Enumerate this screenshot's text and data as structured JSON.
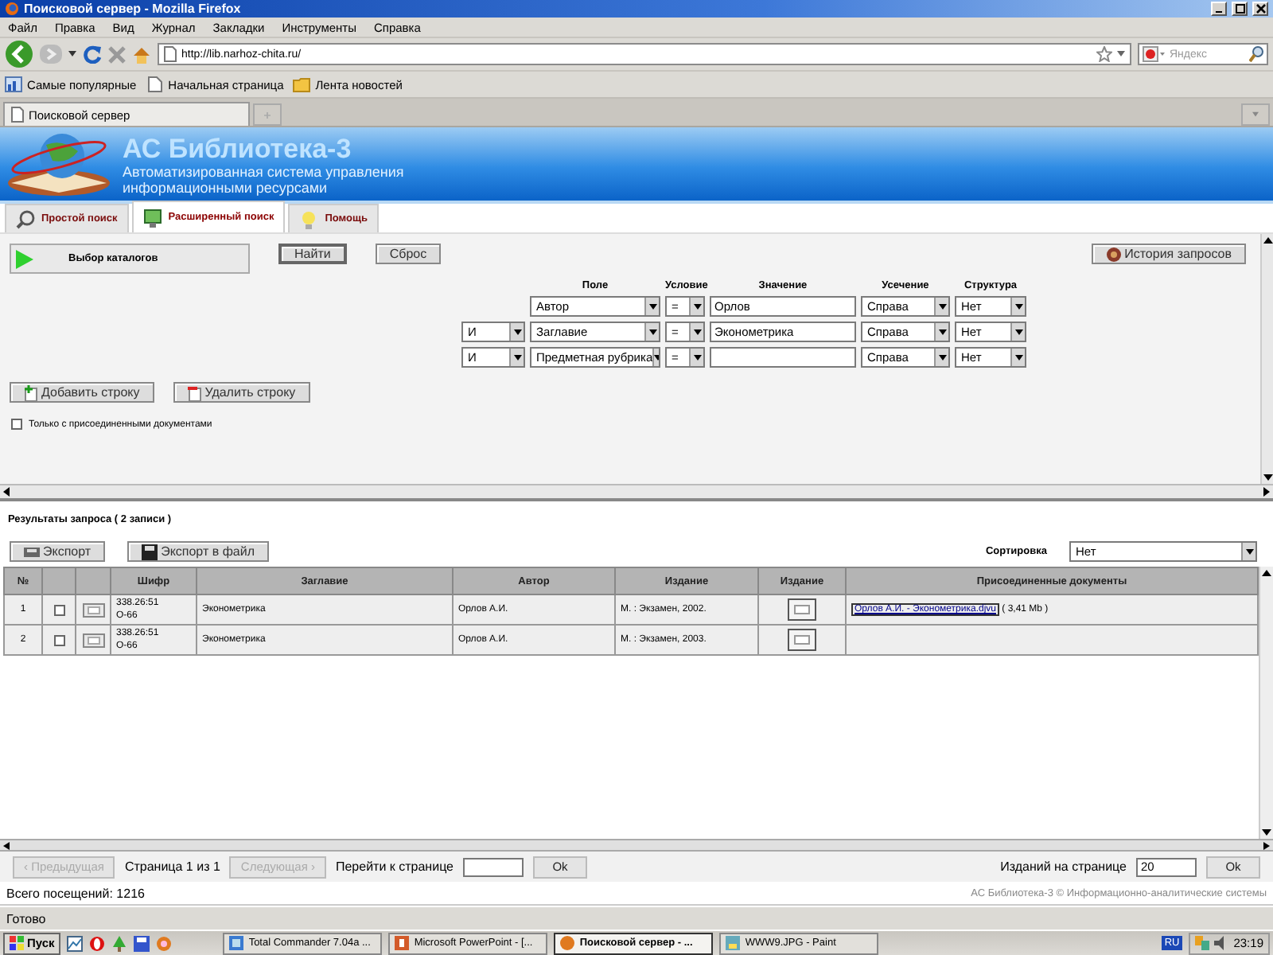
{
  "window": {
    "title": "Поисковой сервер - Mozilla Firefox"
  },
  "menu": [
    "Файл",
    "Правка",
    "Вид",
    "Журнал",
    "Закладки",
    "Инструменты",
    "Справка"
  ],
  "address": "http://lib.narhoz-chita.ru/",
  "web_search": {
    "placeholder": "Яндекс"
  },
  "bookmarks": [
    "Самые популярные",
    "Начальная страница",
    "Лента новостей"
  ],
  "browser_tabs": [
    {
      "label": "Поисковой сервер",
      "selected": true
    }
  ],
  "banner": {
    "title": "АС Библиотека-3",
    "subtitle_lines": [
      "Автоматизированная система управления",
      "информационными ресурсами"
    ]
  },
  "app_tabs": [
    {
      "label": "Простой поиск",
      "selected": false
    },
    {
      "label": "Расширенный поиск",
      "selected": true
    },
    {
      "label": "Помощь",
      "selected": false
    }
  ],
  "search": {
    "catalog_button": "Выбор каталогов",
    "find_button": "Найти",
    "reset_button": "Сброс",
    "history_button": "История запросов",
    "columns": [
      "Поле",
      "Условие",
      "Значение",
      "Усечение",
      "Структура"
    ],
    "rows": [
      {
        "field": "Автор",
        "condition": "=",
        "value": "Орлов",
        "truncation": "Справа",
        "structure": "Нет"
      },
      {
        "logic": "И",
        "field": "Заглавие",
        "condition": "=",
        "value": "Эконометрика",
        "truncation": "Справа",
        "structure": "Нет"
      },
      {
        "logic": "И",
        "field": "Предметная рубрика",
        "condition": "=",
        "truncation": "Справа",
        "structure": "Нет"
      }
    ],
    "add_row_button": "Добавить строку",
    "delete_row_button": "Удалить строку",
    "only_attached": {
      "label": "Только с присоединенными документами",
      "checked": false
    }
  },
  "results": {
    "title": "Результаты запроса ( 2 записи )",
    "export_button": "Экспорт",
    "export_file_button": "Экспорт в файл",
    "sort_label": "Сортировка",
    "sort_value": "Нет",
    "columns": [
      "№",
      "Шифр",
      "Заглавие",
      "Автор",
      "Издание",
      "Издание",
      "Присоединенные документы"
    ],
    "rows": [
      {
        "number": "1",
        "checked": false,
        "code_lines": [
          "338.26:51",
          "О-66"
        ],
        "title": "Эконометрика",
        "author": "Орлов А.И.",
        "edition": "М. : Экзамен, 2002.",
        "document_link": "Орлов А.И. - Эконометрика.djvu",
        "document_size": "( 3,41 Mb )"
      },
      {
        "number": "2",
        "checked": false,
        "code_lines": [
          "338.26:51",
          "О-66"
        ],
        "title": "Эконометрика",
        "author": "Орлов А.И.",
        "edition": "М. : Экзамен, 2003."
      }
    ]
  },
  "pagination": {
    "prev": {
      "label": "‹ Предыдущая",
      "disabled": true
    },
    "page_info": "Страница 1 из 1",
    "next": {
      "label": "Следующая ›",
      "disabled": true
    },
    "goto_label": "Перейти к странице",
    "goto_button": "Ok",
    "per_page_label": "Изданий на странице",
    "per_page_value": "20",
    "per_page_button": "Ok"
  },
  "footer": {
    "visits": "Всего посещений: 1216",
    "copyright": "АС Библиотека-3 © Информационно-аналитические системы"
  },
  "status_bar": "Готово",
  "taskbar": {
    "start": "Пуск",
    "tasks": [
      {
        "label": "Total Commander 7.04a ...",
        "selected": false
      },
      {
        "label": "Microsoft PowerPoint - [...",
        "selected": false
      },
      {
        "label": "Поисковой сервер - ...",
        "selected": true
      },
      {
        "label": "WWW9.JPG - Paint",
        "selected": false
      }
    ],
    "language": "RU",
    "clock": "23:19"
  }
}
